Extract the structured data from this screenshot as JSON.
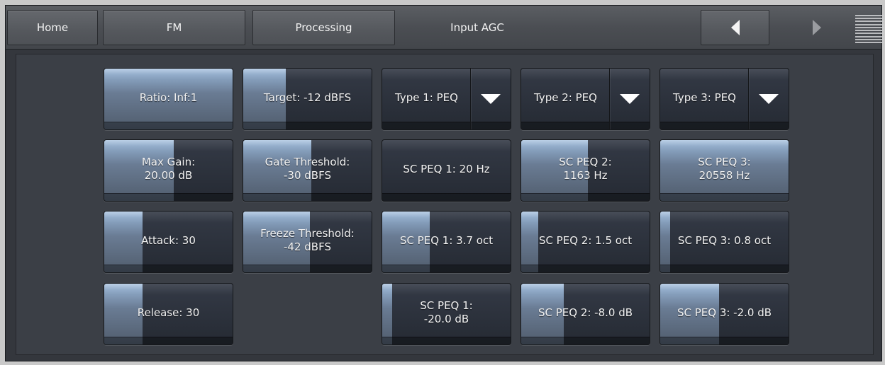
{
  "nav": {
    "home": "Home",
    "fm": "FM",
    "processing": "Processing",
    "title": "Input AGC"
  },
  "buttons": {
    "ratio": {
      "label": "Ratio: Inf:1",
      "level": 1.0
    },
    "target": {
      "label": "Target: -12 dBFS",
      "level": 0.33
    },
    "type1": {
      "label": "Type 1: PEQ",
      "level": 0.0
    },
    "type2": {
      "label": "Type 2: PEQ",
      "level": 0.0
    },
    "type3": {
      "label": "Type 3: PEQ",
      "level": 0.0
    },
    "max_gain_l1": "Max Gain:",
    "max_gain_l2": "20.00 dB",
    "max_gain_level": 0.54,
    "gate_l1": "Gate Threshold:",
    "gate_l2": "-30 dBFS",
    "gate_level": 0.53,
    "scpeq1_freq": {
      "label": "SC PEQ 1: 20 Hz",
      "level": 0.0
    },
    "scpeq2_freq_l1": "SC PEQ 2:",
    "scpeq2_freq_l2": "1163 Hz",
    "scpeq2_freq_level": 0.52,
    "scpeq3_freq_l1": "SC PEQ 3:",
    "scpeq3_freq_l2": "20558 Hz",
    "scpeq3_freq_level": 1.0,
    "attack": {
      "label": "Attack: 30",
      "level": 0.3
    },
    "freeze_l1": "Freeze Threshold:",
    "freeze_l2": "-42 dBFS",
    "freeze_level": 0.52,
    "scpeq1_bw": {
      "label": "SC PEQ 1: 3.7 oct",
      "level": 0.37
    },
    "scpeq2_bw": {
      "label": "SC PEQ 2: 1.5 oct",
      "level": 0.13
    },
    "scpeq3_bw": {
      "label": "SC PEQ 3: 0.8 oct",
      "level": 0.08
    },
    "release": {
      "label": "Release: 30",
      "level": 0.3
    },
    "scpeq1_gain_l1": "SC PEQ 1:",
    "scpeq1_gain_l2": "-20.0 dB",
    "scpeq1_gain_level": 0.08,
    "scpeq2_gain": {
      "label": "SC PEQ 2: -8.0 dB",
      "level": 0.33
    },
    "scpeq3_gain": {
      "label": "SC PEQ 3: -2.0 dB",
      "level": 0.46
    }
  },
  "colors": {
    "panel_bg": "#3b3f46",
    "fill_top": "#b4cbe4",
    "fill_bottom": "#505c6c",
    "text": "#f3f3f3"
  },
  "icons": {
    "prev": "arrow-left-icon",
    "next": "arrow-right-icon",
    "menu": "menu-lines-icon",
    "dropdown": "caret-down-icon"
  }
}
